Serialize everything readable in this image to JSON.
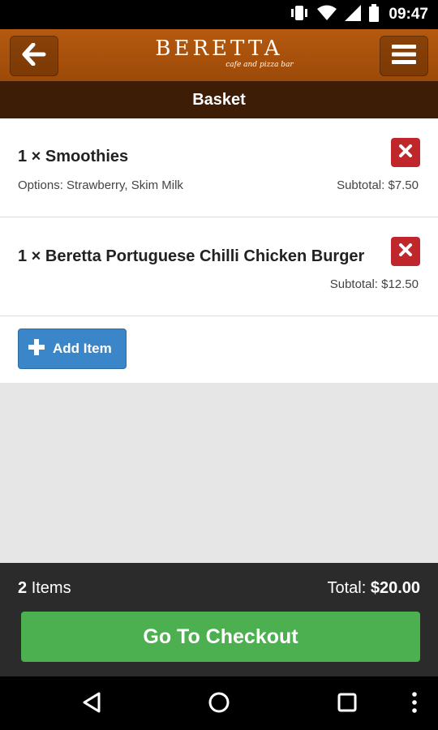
{
  "status_bar": {
    "time": "09:47"
  },
  "header": {
    "brand_name": "BERETTA",
    "brand_tagline": "cafe and pizza bar"
  },
  "page": {
    "title": "Basket"
  },
  "basket": {
    "items": [
      {
        "title": "1 × Smoothies",
        "options": "Options: Strawberry, Skim Milk",
        "subtotal": "Subtotal: $7.50"
      },
      {
        "title": "1 × Beretta Portuguese Chilli Chicken Burger",
        "options": "",
        "subtotal": "Subtotal: $12.50"
      }
    ],
    "add_item_label": "Add Item"
  },
  "footer": {
    "item_count": "2",
    "item_count_suffix": "Items",
    "total_label": "Total:",
    "total_value": "$20.00",
    "checkout_label": "Go To Checkout"
  },
  "colors": {
    "header": "#a9520c",
    "sub_header": "#3d1d05",
    "remove": "#c0272d",
    "add_button": "#3a86c8",
    "checkout": "#4caf50",
    "footer": "#2b2b2b"
  },
  "icons": {
    "status": [
      "vibrate-icon",
      "wifi-icon",
      "signal-icon",
      "battery-icon"
    ],
    "header": [
      "back-arrow-icon",
      "hamburger-menu-icon"
    ],
    "nav": [
      "nav-back-icon",
      "nav-home-icon",
      "nav-recents-icon",
      "overflow-menu-icon"
    ]
  }
}
